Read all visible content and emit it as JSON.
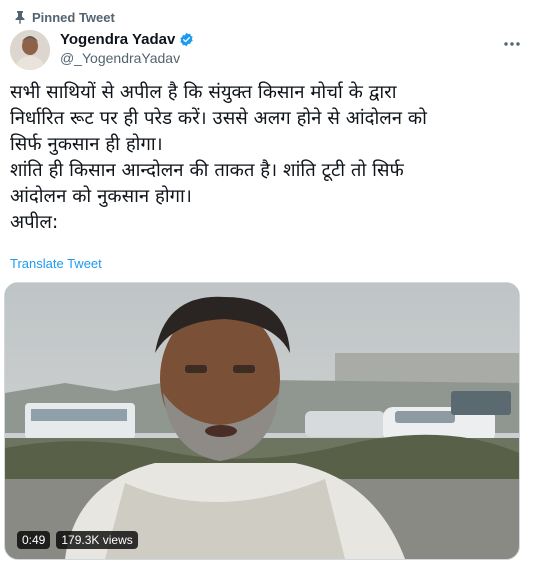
{
  "pinned": {
    "label": "Pinned Tweet",
    "icon": "pin-icon"
  },
  "author": {
    "display_name": "Yogendra Yadav",
    "handle": "@_YogendraYadav",
    "verified": true,
    "verified_color": "#1d9bf0"
  },
  "tweet": {
    "text": "सभी साथियों से अपील है कि संयुक्त किसान मोर्चा के द्वारा\nनिर्धारित रूट पर ही परेड करें। उससे अलग होने से आंदोलन को\nसिर्फ नुकसान ही होगा।\nशांति ही किसान आन्दोलन की ताकत है। शांति टूटी तो सिर्फ\nआंदोलन को नुकसान होगा।\nअपील:",
    "translate_label": "Translate Tweet"
  },
  "video": {
    "duration": "0:49",
    "views": "179.3K views"
  },
  "colors": {
    "link": "#1d9bf0",
    "secondary_text": "#536471",
    "border": "#cfd9de"
  }
}
